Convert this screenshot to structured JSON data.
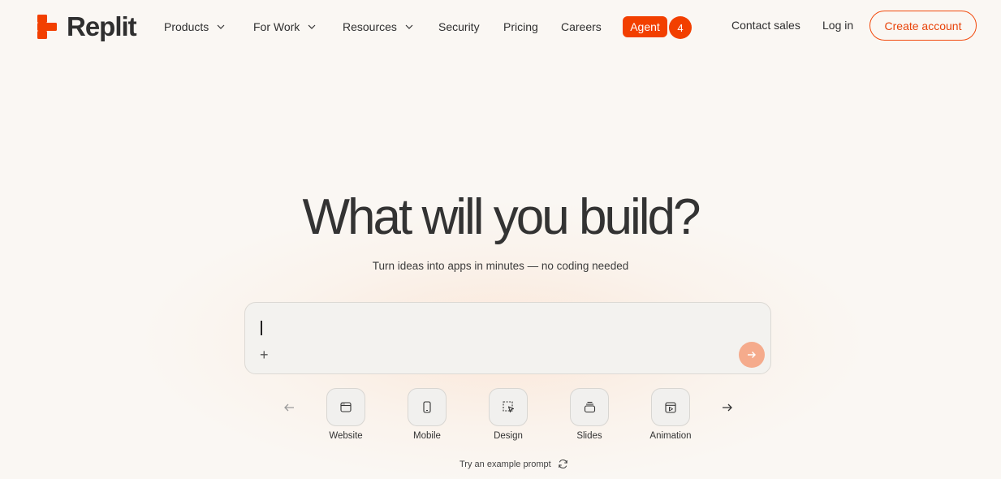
{
  "header": {
    "logo_text": "Replit",
    "nav": [
      {
        "label": "Products",
        "has_dropdown": true
      },
      {
        "label": "For Work",
        "has_dropdown": true
      },
      {
        "label": "Resources",
        "has_dropdown": true
      },
      {
        "label": "Security",
        "has_dropdown": false
      },
      {
        "label": "Pricing",
        "has_dropdown": false
      },
      {
        "label": "Careers",
        "has_dropdown": false
      }
    ],
    "agent_label": "Agent",
    "agent_badge": "4",
    "contact_sales": "Contact sales",
    "login": "Log in",
    "create_account": "Create account"
  },
  "hero": {
    "title": "What will you build?",
    "subtitle": "Turn ideas into apps in minutes — no coding needed"
  },
  "prompt": {
    "value": "",
    "attach_icon": "plus-icon",
    "send_icon": "arrow-right-icon"
  },
  "categories": [
    {
      "label": "Website",
      "icon": "browser-window-icon"
    },
    {
      "label": "Mobile",
      "icon": "phone-icon"
    },
    {
      "label": "Design",
      "icon": "select-cursor-icon"
    },
    {
      "label": "Slides",
      "icon": "slides-stack-icon"
    },
    {
      "label": "Animation",
      "icon": "play-window-icon"
    }
  ],
  "example_prompt": "Try an example prompt",
  "colors": {
    "accent": "#f23f00",
    "background": "#faf7f3",
    "send_button": "#f5ab8c"
  }
}
